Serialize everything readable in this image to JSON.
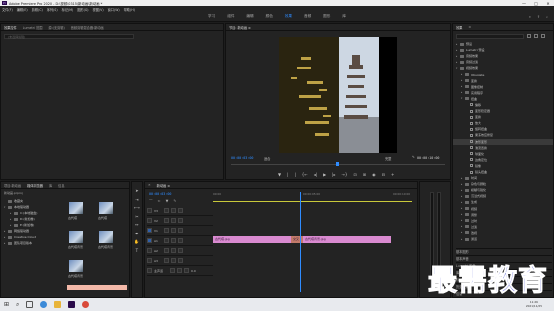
{
  "window": {
    "title": "Adobe Premiere Pro 2020 - D:\\视频\\0315\\新动画\\新动画 *",
    "minimize": "—",
    "maximize": "□",
    "close": "✕"
  },
  "menu": [
    "文件(F)",
    "编辑(E)",
    "剪辑(C)",
    "序列(S)",
    "标记(M)",
    "图形(G)",
    "视图(V)",
    "窗口(W)",
    "帮助(H)"
  ],
  "workspaces": [
    "学习",
    "组件",
    "编辑",
    "颜色",
    "效果",
    "音频",
    "图形",
    "库"
  ],
  "active_workspace": "效果",
  "source_panel": {
    "tabs": [
      "效果控件",
      "Lumetri 范围",
      "源:(无剪辑)",
      "音频剪辑混合器:新动画"
    ],
    "search_placeholder": "(未选择剪辑)"
  },
  "program_monitor": {
    "tab": "节目: 新动画 ≡",
    "timecode_left": "00:00:03:00",
    "fit": "适合",
    "quality": "完整",
    "timecode_right": "00:00:10:00"
  },
  "project_panel": {
    "tabs": [
      "项目:新动画",
      "媒体浏览器",
      "库",
      "信息",
      "效果",
      "标记"
    ],
    "path": "新动画.prproj"
  },
  "media_tree": [
    {
      "label": "收藏夹",
      "arrow": ""
    },
    {
      "label": "本地驱动器",
      "arrow": "▾"
    },
    {
      "label": "C:(本地磁盘)",
      "arrow": "▸"
    },
    {
      "label": "D:(新加卷)",
      "arrow": "▸"
    },
    {
      "label": "E:(新加卷)",
      "arrow": "▸"
    },
    {
      "label": "网络驱动器",
      "arrow": "▸"
    },
    {
      "label": "Creative Cloud",
      "arrow": "▸"
    },
    {
      "label": "团队项目版本",
      "arrow": "▸"
    }
  ],
  "media_items": [
    {
      "name": "古代塔",
      "row": 0
    },
    {
      "name": "古代塔",
      "row": 0
    },
    {
      "name": "古代塔背景",
      "row": 1
    },
    {
      "name": "古代塔背景",
      "row": 1
    },
    {
      "name": "古代塔背景",
      "row": 2
    }
  ],
  "timeline": {
    "tab": "新动画 ≡",
    "timecode": "00:00:03:00",
    "ruler": [
      "00:00",
      "00:00:05:00",
      "00:00:10:00"
    ],
    "tracks": [
      "V3",
      "V2",
      "V1",
      "A1",
      "A2",
      "A3",
      "主声道"
    ],
    "clips": [
      {
        "label": "古代塔.jpg"
      },
      {
        "label": "交叉"
      },
      {
        "label": "古代塔背景.jpg"
      }
    ],
    "master_value": "0.0"
  },
  "effects_panel": {
    "tabs": [
      "效果",
      "≡"
    ],
    "tree": [
      {
        "label": "预设",
        "arrow": "▸",
        "indent": 0,
        "kind": "folder"
      },
      {
        "label": "Lumetri 预设",
        "arrow": "▸",
        "indent": 0,
        "kind": "folder"
      },
      {
        "label": "音频效果",
        "arrow": "▸",
        "indent": 0,
        "kind": "folder"
      },
      {
        "label": "音频过渡",
        "arrow": "▸",
        "indent": 0,
        "kind": "folder"
      },
      {
        "label": "视频效果",
        "arrow": "▾",
        "indent": 0,
        "kind": "folder"
      },
      {
        "label": "Obsolete",
        "arrow": "▸",
        "indent": 1,
        "kind": "folder"
      },
      {
        "label": "变换",
        "arrow": "▸",
        "indent": 1,
        "kind": "folder"
      },
      {
        "label": "图像控制",
        "arrow": "▸",
        "indent": 1,
        "kind": "folder"
      },
      {
        "label": "实用程序",
        "arrow": "▸",
        "indent": 1,
        "kind": "folder"
      },
      {
        "label": "扭曲",
        "arrow": "▾",
        "indent": 1,
        "kind": "folder"
      },
      {
        "label": "偏移",
        "arrow": "",
        "indent": 2,
        "kind": "fx"
      },
      {
        "label": "变形稳定器",
        "arrow": "",
        "indent": 2,
        "kind": "fx"
      },
      {
        "label": "变换",
        "arrow": "",
        "indent": 2,
        "kind": "fx"
      },
      {
        "label": "放大",
        "arrow": "",
        "indent": 2,
        "kind": "fx"
      },
      {
        "label": "旋转扭曲",
        "arrow": "",
        "indent": 2,
        "kind": "fx"
      },
      {
        "label": "果冻效应修复",
        "arrow": "",
        "indent": 2,
        "kind": "fx"
      },
      {
        "label": "波形变形",
        "arrow": "",
        "indent": 2,
        "kind": "fx",
        "selected": true
      },
      {
        "label": "湍流置换",
        "arrow": "",
        "indent": 2,
        "kind": "fx"
      },
      {
        "label": "球面化",
        "arrow": "",
        "indent": 2,
        "kind": "fx"
      },
      {
        "label": "边角定位",
        "arrow": "",
        "indent": 2,
        "kind": "fx"
      },
      {
        "label": "镜像",
        "arrow": "",
        "indent": 2,
        "kind": "fx"
      },
      {
        "label": "镜头扭曲",
        "arrow": "",
        "indent": 2,
        "kind": "fx"
      },
      {
        "label": "时间",
        "arrow": "▸",
        "indent": 1,
        "kind": "folder"
      },
      {
        "label": "杂色与颗粒",
        "arrow": "▸",
        "indent": 1,
        "kind": "folder"
      },
      {
        "label": "模糊与锐化",
        "arrow": "▸",
        "indent": 1,
        "kind": "folder"
      },
      {
        "label": "沉浸式视频",
        "arrow": "▸",
        "indent": 1,
        "kind": "folder"
      },
      {
        "label": "生成",
        "arrow": "▸",
        "indent": 1,
        "kind": "folder"
      },
      {
        "label": "视频",
        "arrow": "▸",
        "indent": 1,
        "kind": "folder"
      },
      {
        "label": "调整",
        "arrow": "▸",
        "indent": 1,
        "kind": "folder"
      },
      {
        "label": "过时",
        "arrow": "▸",
        "indent": 1,
        "kind": "folder"
      },
      {
        "label": "过渡",
        "arrow": "▸",
        "indent": 1,
        "kind": "folder"
      },
      {
        "label": "透视",
        "arrow": "▸",
        "indent": 1,
        "kind": "folder"
      },
      {
        "label": "通道",
        "arrow": "▸",
        "indent": 1,
        "kind": "folder"
      }
    ],
    "sections": [
      "基本图形",
      "基本声音",
      "Lumetri 颜色",
      "库",
      "标记",
      "历史记录",
      "信息"
    ]
  },
  "taskbar": {
    "time": "11:26",
    "date": "2021/11/25"
  },
  "watermark": "最需教育"
}
